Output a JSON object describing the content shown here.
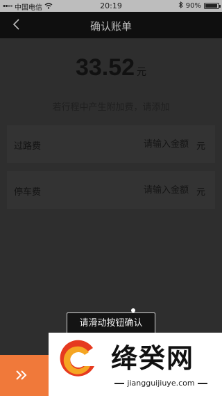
{
  "status_bar": {
    "carrier": "中国电信",
    "time": "20:19",
    "battery": "90%",
    "battery_level": 0.9
  },
  "header": {
    "title": "确认账单"
  },
  "bill": {
    "amount": "33.52",
    "unit": "元",
    "hint": "若行程中产生附加费，请添加"
  },
  "fees": [
    {
      "label": "过路费",
      "placeholder": "请输入金额",
      "unit": "元"
    },
    {
      "label": "停车费",
      "placeholder": "请输入金额",
      "unit": "元"
    }
  ],
  "slider": {
    "tooltip": "请滑动按钮确认"
  },
  "watermark": {
    "brand": "绛癸网",
    "url": "jiangguijiuye.com"
  },
  "colors": {
    "accent": "#f0793a",
    "nav_bg": "#0f0f0f",
    "overlay_bg": "#2e2e2e"
  }
}
